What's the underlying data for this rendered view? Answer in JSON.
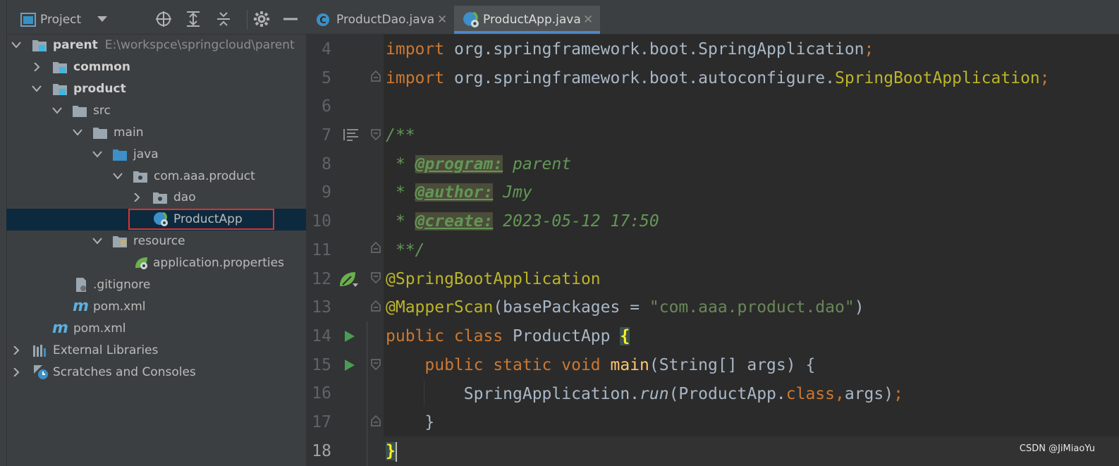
{
  "project_panel": {
    "title": "Project",
    "tree": [
      {
        "label": "parent",
        "path": "E:\\workspce\\springcloud\\parent"
      },
      {
        "label": "common"
      },
      {
        "label": "product"
      },
      {
        "label": "src"
      },
      {
        "label": "main"
      },
      {
        "label": "java"
      },
      {
        "label": "com.aaa.product"
      },
      {
        "label": "dao"
      },
      {
        "label": "ProductApp"
      },
      {
        "label": "resource"
      },
      {
        "label": "application.properties"
      },
      {
        "label": ".gitignore"
      },
      {
        "label": "pom.xml"
      },
      {
        "label": "pom.xml"
      },
      {
        "label": "External Libraries"
      },
      {
        "label": "Scratches and Consoles"
      }
    ]
  },
  "editor": {
    "tabs": [
      {
        "label": "ProductDao.java",
        "close": "✕"
      },
      {
        "label": "ProductApp.java",
        "close": "✕"
      }
    ],
    "line_numbers": [
      "4",
      "5",
      "6",
      "7",
      "8",
      "9",
      "10",
      "11",
      "12",
      "13",
      "14",
      "15",
      "16",
      "17",
      "18"
    ],
    "code": {
      "l4_import": "import",
      "l4_pkg": " org.springframework.boot.SpringApplication",
      "l4_semi": ";",
      "l5_import": "import",
      "l5_pkg": " org.springframework.boot.autoconfigure.",
      "l5_cls": "SpringBootApplication",
      "l5_semi": ";",
      "l7": "/**",
      "l8_pre": " * ",
      "l8_tag": "@program:",
      "l8_val": " parent",
      "l9_pre": " * ",
      "l9_tag": "@author:",
      "l9_val": " Jmy",
      "l10_pre": " * ",
      "l10_tag": "@create:",
      "l10_val": " 2023-05-12 17:50",
      "l11": " **/",
      "l12": "@SpringBootApplication",
      "l13_ann": "@MapperScan",
      "l13_mid": "(basePackages = ",
      "l13_str": "\"com.aaa.product.dao\"",
      "l13_end": ")",
      "l14_kw": "public class",
      "l14_name": " ProductApp ",
      "l14_brace": "{",
      "l15_indent": "    ",
      "l15_kw": "public static void",
      "l15_sp": " ",
      "l15_meth": "main",
      "l15_rest": "(String[] args) {",
      "l16_indent": "        ",
      "l16_a": "SpringApplication.",
      "l16_run": "run",
      "l16_b": "(ProductApp.",
      "l16_class": "class,",
      "l16_c": "args)",
      "l16_semi": ";",
      "l17": "    }",
      "l18_brace": "}"
    }
  },
  "watermark": "CSDN @JiMiaoYu",
  "colors": {
    "panel_bg": "#3c3f41",
    "editor_bg": "#2b2b2b",
    "keyword": "#cc7832",
    "annotation": "#bbb529",
    "string": "#6a8759",
    "doc_comment": "#629755",
    "selection": "#0d293e",
    "highlight_box": "#e0302f"
  }
}
